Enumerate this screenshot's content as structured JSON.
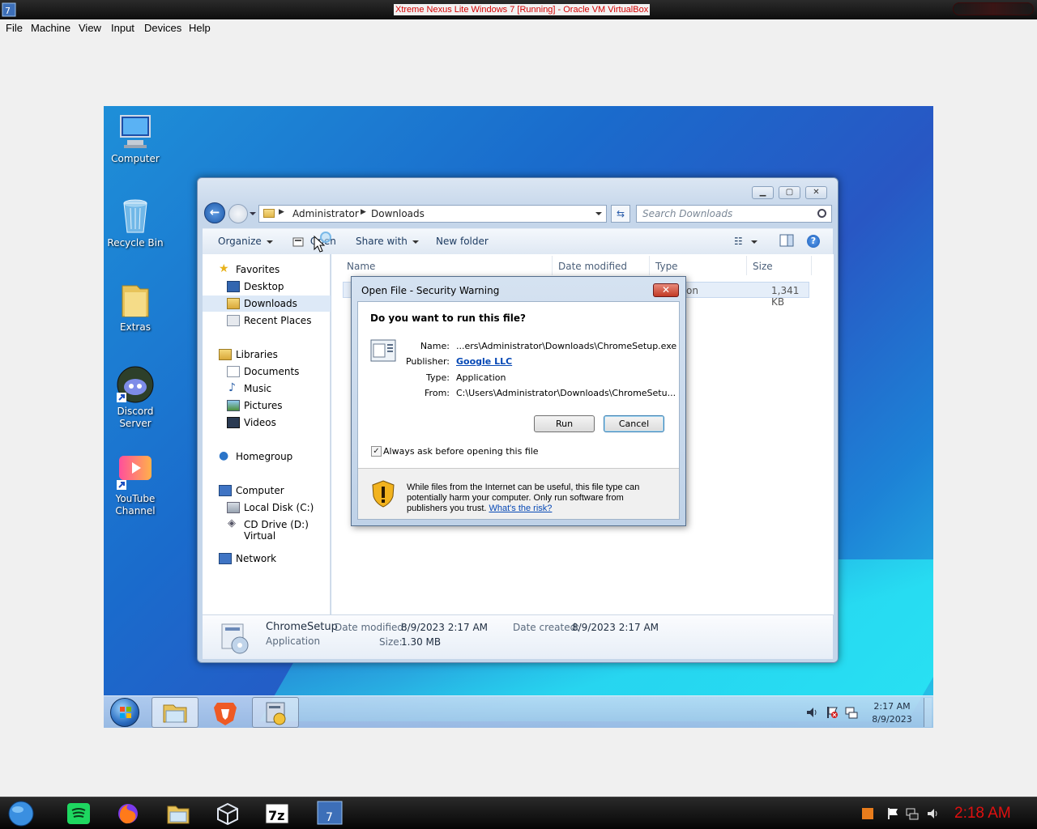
{
  "host": {
    "window_title": "Xtreme Nexus Lite Windows 7 [Running] - Oracle VM VirtualBox",
    "menu": [
      "File",
      "Machine",
      "View",
      "Input",
      "Devices",
      "Help"
    ],
    "clock": "2:18 AM",
    "taskbar_icons": [
      "globe-icon",
      "spotify-icon",
      "firefox-icon",
      "file-manager-icon",
      "virtualbox-icon",
      "7zip-icon",
      "xtreme-nexus-icon"
    ]
  },
  "desktop": {
    "icons": [
      {
        "label": "Computer",
        "icon": "computer-icon"
      },
      {
        "label": "Recycle Bin",
        "icon": "recycle-bin-icon"
      },
      {
        "label": "Extras",
        "icon": "folder-icon"
      },
      {
        "label": "Discord Server",
        "icon": "discord-icon"
      },
      {
        "label": "YouTube Channel",
        "icon": "youtube-icon"
      }
    ]
  },
  "explorer": {
    "breadcrumb": [
      "Administrator",
      "Downloads"
    ],
    "search_placeholder": "Search Downloads",
    "commands": {
      "organize": "Organize",
      "open": "Open",
      "share_with": "Share with",
      "new_folder": "New folder"
    },
    "nav": {
      "favorites": "Favorites",
      "desktop": "Desktop",
      "downloads": "Downloads",
      "recent_places": "Recent Places",
      "libraries": "Libraries",
      "documents": "Documents",
      "music": "Music",
      "pictures": "Pictures",
      "videos": "Videos",
      "homegroup": "Homegroup",
      "computer": "Computer",
      "local_disk": "Local Disk (C:)",
      "cd_drive": "CD Drive (D:) Virtual",
      "network": "Network"
    },
    "columns": {
      "name": "Name",
      "date_modified": "Date modified",
      "type": "Type",
      "size": "Size"
    },
    "file_row": {
      "type_partial": "tion",
      "size": "1,341 KB"
    },
    "details": {
      "file_name": "ChromeSetup",
      "file_kind": "Application",
      "date_modified_label": "Date modified:",
      "date_modified_value": "8/9/2023 2:17 AM",
      "size_label": "Size:",
      "size_value": "1.30 MB",
      "date_created_label": "Date created:",
      "date_created_value": "8/9/2023 2:17 AM"
    }
  },
  "security_dialog": {
    "title": "Open File - Security Warning",
    "question": "Do you want to run this file?",
    "fields": {
      "name_label": "Name:",
      "name_value": "...ers\\Administrator\\Downloads\\ChromeSetup.exe",
      "publisher_label": "Publisher:",
      "publisher_value": "Google LLC",
      "type_label": "Type:",
      "type_value": "Application",
      "from_label": "From:",
      "from_value": "C:\\Users\\Administrator\\Downloads\\ChromeSetu..."
    },
    "run_label": "Run",
    "cancel_label": "Cancel",
    "checkbox_label": "Always ask before opening this file",
    "checkbox_checked": true,
    "warning_text": "While files from the Internet can be useful, this file type can potentially harm your computer. Only run software from publishers you trust.",
    "risk_link": "What's the risk?"
  },
  "guest_taskbar": {
    "time": "2:17 AM",
    "date": "8/9/2023",
    "pinned": [
      "windows-explorer-icon",
      "brave-icon",
      "installer-icon"
    ]
  }
}
